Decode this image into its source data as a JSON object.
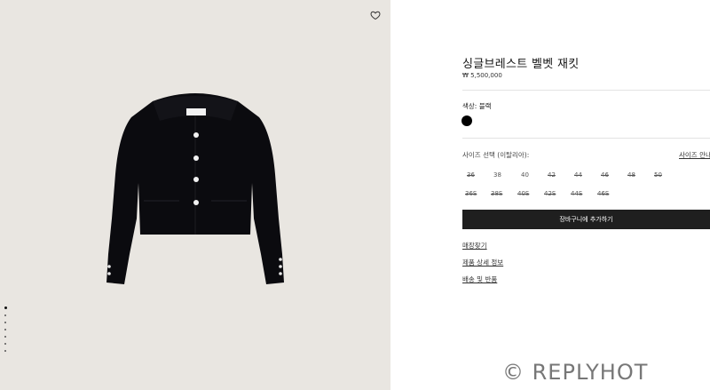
{
  "product": {
    "title": "싱글브레스트 벨벳 재킷",
    "price": "₩ 5,500,000"
  },
  "color": {
    "label": "색상: 블랙",
    "swatch_color": "#000000"
  },
  "size_section": {
    "label": "사이즈 선택 (이탈리아):",
    "guide_link": "사이즈 안내",
    "sizes": [
      {
        "label": "36",
        "available": false
      },
      {
        "label": "38",
        "available": true
      },
      {
        "label": "40",
        "available": true
      },
      {
        "label": "42",
        "available": false
      },
      {
        "label": "44",
        "available": false
      },
      {
        "label": "46",
        "available": false
      },
      {
        "label": "48",
        "available": false
      },
      {
        "label": "50",
        "available": false
      },
      {
        "label": "36S",
        "available": false
      },
      {
        "label": "38S",
        "available": false
      },
      {
        "label": "40S",
        "available": false
      },
      {
        "label": "42S",
        "available": false
      },
      {
        "label": "44S",
        "available": false
      },
      {
        "label": "46S",
        "available": false
      }
    ]
  },
  "cart_button": "장바구니에 추가하기",
  "links": {
    "store_locator": "매장찾기",
    "product_details": "제품 상세 정보",
    "shipping_returns": "배송 및 반품"
  },
  "gallery": {
    "dot_count": 7,
    "active_index": 0,
    "label_tag": "Miu Miu"
  },
  "watermark": "© REPLYHOT",
  "colors": {
    "gallery_bg": "#e9e6e1",
    "button_bg": "#1f1f1f",
    "jacket": "#0b0b0f"
  }
}
